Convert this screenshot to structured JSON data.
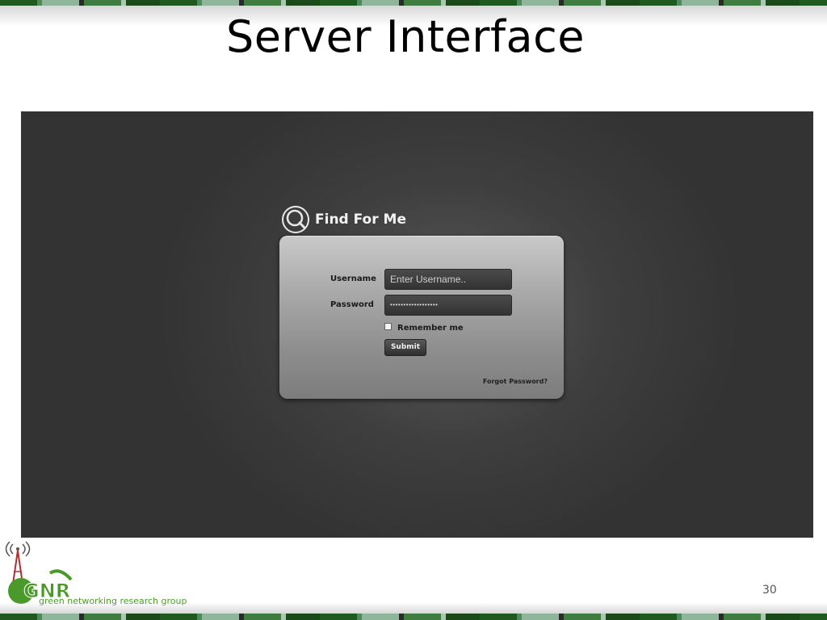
{
  "slide": {
    "title": "Server Interface",
    "page_number": "30"
  },
  "app": {
    "brand_name": "Find For Me",
    "brand_icon": "search-icon"
  },
  "login": {
    "username_label": "Username",
    "username_placeholder": "Enter Username..",
    "password_label": "Password",
    "password_value": "••••••••••••••••••",
    "remember_label": "Remember me",
    "remember_checked": false,
    "submit_label": "Submit",
    "forgot_label": "Forgot Password?"
  },
  "logo": {
    "text": "GNR",
    "tagline": "green networking research group"
  },
  "colors": {
    "screen_bg": "#3e3e3e",
    "card_bg": "#a9a9a9",
    "brand_green": "#4a9a2a"
  }
}
